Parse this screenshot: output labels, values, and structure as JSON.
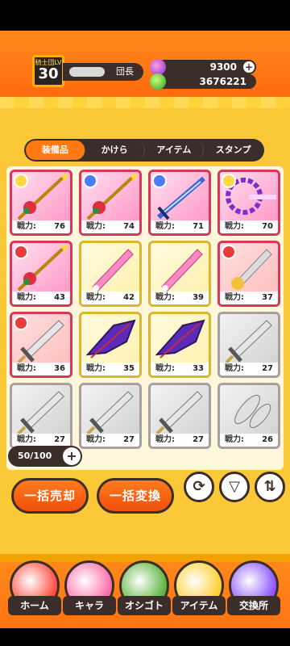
{
  "header": {
    "level_label": "騎士団LV",
    "level": "30",
    "role": "団長",
    "gems": "9300",
    "coins": "3676221"
  },
  "tabs": [
    {
      "label": "装備品",
      "active": true
    },
    {
      "label": "かけら",
      "active": false
    },
    {
      "label": "アイテム",
      "active": false
    },
    {
      "label": "スタンプ",
      "active": false
    }
  ],
  "power_label": "戦力:",
  "items": [
    {
      "power": "76",
      "bg": "pink",
      "avatar": "gold",
      "weapon": "spear-red"
    },
    {
      "power": "74",
      "bg": "pink",
      "avatar": "blue",
      "weapon": "spear-red"
    },
    {
      "power": "71",
      "bg": "pink",
      "avatar": "blue",
      "weapon": "sword-blue"
    },
    {
      "power": "70",
      "bg": "pink",
      "avatar": "gold",
      "weapon": "dragon-purple"
    },
    {
      "power": "43",
      "bg": "pink",
      "avatar": "red",
      "weapon": "spear-red"
    },
    {
      "power": "42",
      "bg": "yellow",
      "avatar": "",
      "weapon": "blade-pink"
    },
    {
      "power": "39",
      "bg": "yellow",
      "avatar": "",
      "weapon": "blade-pink"
    },
    {
      "power": "37",
      "bg": "red",
      "avatar": "red",
      "weapon": "sword-gold"
    },
    {
      "power": "36",
      "bg": "red",
      "avatar": "red",
      "weapon": "sword-grey"
    },
    {
      "power": "35",
      "bg": "yellow",
      "avatar": "",
      "weapon": "wing-purple"
    },
    {
      "power": "33",
      "bg": "yellow",
      "avatar": "",
      "weapon": "wing-purple"
    },
    {
      "power": "27",
      "bg": "grey",
      "avatar": "",
      "weapon": "sword-grey"
    },
    {
      "power": "27",
      "bg": "grey",
      "avatar": "",
      "weapon": "sword-grey"
    },
    {
      "power": "27",
      "bg": "grey",
      "avatar": "",
      "weapon": "sword-grey"
    },
    {
      "power": "27",
      "bg": "grey",
      "avatar": "",
      "weapon": "sword-grey"
    },
    {
      "power": "26",
      "bg": "grey",
      "avatar": "",
      "weapon": "leaf-grey"
    }
  ],
  "capacity": "50/100",
  "actions": {
    "sell_all": "一括売却",
    "convert_all": "一括変換"
  },
  "nav": [
    {
      "label": "ホーム",
      "color": "#ff4b3e"
    },
    {
      "label": "キャラ",
      "color": "#ff6aa8"
    },
    {
      "label": "オシゴト",
      "color": "#5ab53a"
    },
    {
      "label": "アイテム",
      "color": "#ffcf2e"
    },
    {
      "label": "交換所",
      "color": "#8c52ff"
    }
  ]
}
